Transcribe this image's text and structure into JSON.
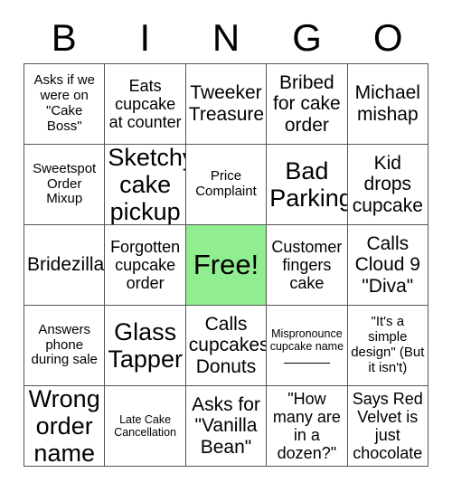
{
  "card": {
    "header_letters": [
      "B",
      "I",
      "N",
      "G",
      "O"
    ],
    "free_space_color": "#90ee90",
    "border_color": "#555555",
    "rows": [
      [
        {
          "text": "Asks if we were on \"Cake Boss\"",
          "size": "sm",
          "free": false
        },
        {
          "text": "Eats cupcake at counter",
          "size": "md",
          "free": false
        },
        {
          "text": "Tweeker Treasure",
          "size": "lg",
          "free": false
        },
        {
          "text": "Bribed for cake order",
          "size": "lg",
          "free": false
        },
        {
          "text": "Michael mishap",
          "size": "lg",
          "free": false
        }
      ],
      [
        {
          "text": "Sweetspot Order Mixup",
          "size": "sm",
          "free": false
        },
        {
          "text": "Sketchy cake pickup",
          "size": "xl",
          "free": false
        },
        {
          "text": "Price Complaint",
          "size": "sm",
          "free": false
        },
        {
          "text": "Bad Parking",
          "size": "xl",
          "free": false
        },
        {
          "text": "Kid drops cupcake",
          "size": "lg",
          "free": false
        }
      ],
      [
        {
          "text": "Bridezilla",
          "size": "lg",
          "free": false
        },
        {
          "text": "Forgotten cupcake order",
          "size": "md",
          "free": false
        },
        {
          "text": "Free!",
          "size": "xl",
          "free": true
        },
        {
          "text": "Customer fingers cake",
          "size": "md",
          "free": false
        },
        {
          "text": "Calls Cloud 9 \"Diva\"",
          "size": "lg",
          "free": false
        }
      ],
      [
        {
          "text": "Answers phone during sale",
          "size": "sm",
          "free": false
        },
        {
          "text": "Glass Tapper",
          "size": "xl",
          "free": false
        },
        {
          "text": "Calls cupcakes Donuts",
          "size": "lg",
          "free": false
        },
        {
          "text": "Mispronounce cupcake name",
          "size": "xs",
          "free": false,
          "blank_rule": true
        },
        {
          "text": "\"It's a simple design\" (But it isn't)",
          "size": "sm",
          "free": false
        }
      ],
      [
        {
          "text": "Wrong order name",
          "size": "xl",
          "free": false
        },
        {
          "text": "Late Cake Cancellation",
          "size": "xs",
          "free": false
        },
        {
          "text": "Asks for \"Vanilla Bean\"",
          "size": "lg",
          "free": false
        },
        {
          "text": "\"How many are in a dozen?\"",
          "size": "md",
          "free": false
        },
        {
          "text": "Says Red Velvet is just chocolate",
          "size": "md",
          "free": false
        }
      ]
    ]
  }
}
